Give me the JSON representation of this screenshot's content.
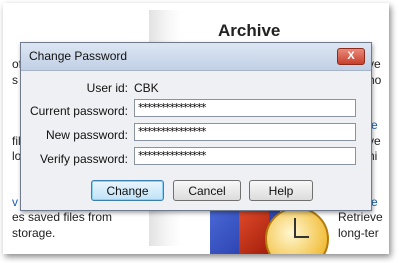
{
  "background": {
    "heading": "Archive",
    "left_fragments": [
      "of",
      "s",
      "",
      "",
      "file",
      "lo",
      "",
      "",
      "es saved files from",
      "storage."
    ],
    "right_fragments": [
      "ve",
      "ho",
      "",
      "e",
      "ve",
      "hi",
      "",
      "e",
      "Retrieve",
      "long-ter"
    ]
  },
  "dialog": {
    "title": "Change Password",
    "close_label": "X",
    "user_id_label": "User id:",
    "user_id_value": "CBK",
    "current_password_label": "Current password:",
    "current_password_value": "***************",
    "new_password_label": "New password:",
    "new_password_value": "***************",
    "verify_password_label": "Verify password:",
    "verify_password_value": "***************",
    "change_label": "Change",
    "cancel_label": "Cancel",
    "help_label": "Help"
  },
  "colors": {
    "title_bar": "#c2d0e6",
    "dialog_bg": "#eef0f4",
    "close_button": "#c8402c",
    "link": "#1a5fb4"
  }
}
